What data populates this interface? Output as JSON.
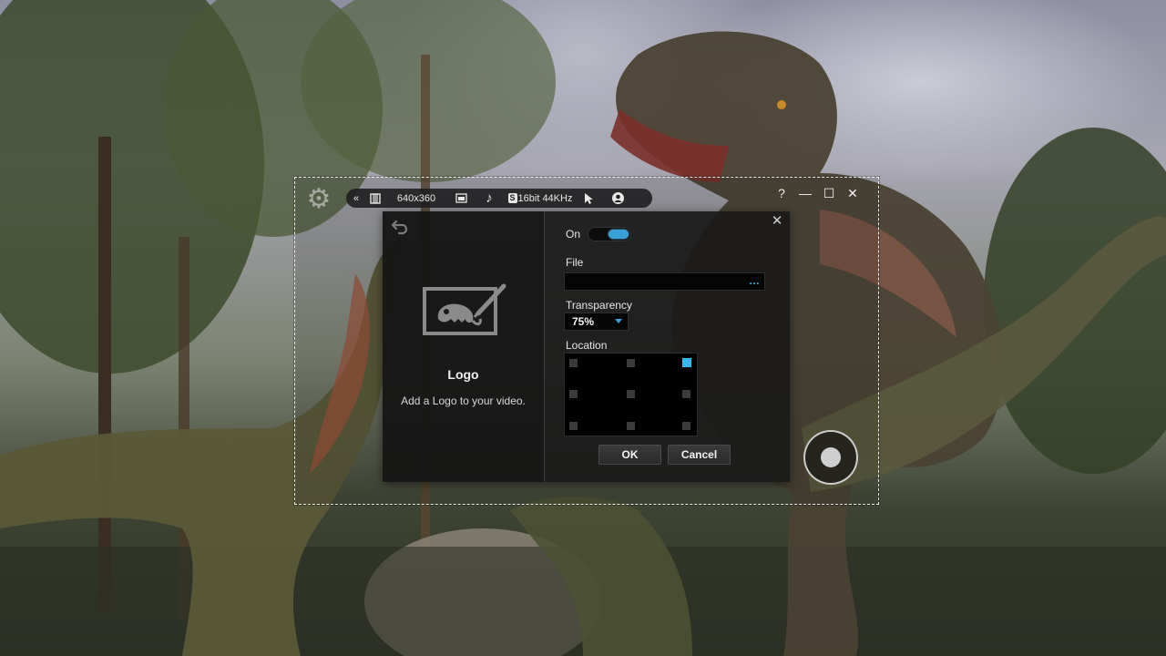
{
  "toolbar": {
    "resolution": "640x360",
    "audio": "16bit 44KHz",
    "audio_badge": "S"
  },
  "dialog": {
    "title": "Logo",
    "description": "Add a Logo to your video.",
    "on_label": "On",
    "on_state": true,
    "file_label": "File",
    "file_value": "",
    "browse_label": "…",
    "transparency_label": "Transparency",
    "transparency_value": "75%",
    "location_label": "Location",
    "location_selected": "top-right",
    "ok_label": "OK",
    "cancel_label": "Cancel"
  },
  "colors": {
    "accent": "#3aa0d8",
    "dialog_bg": "#1a1a1a"
  },
  "icons": [
    "gear-icon",
    "collapse-icon",
    "film-icon",
    "window-icon",
    "music-note-icon",
    "cursor-icon",
    "webcam-icon",
    "help-icon",
    "minimize-icon",
    "maximize-icon",
    "close-icon",
    "back-arrow-icon",
    "logo-chameleon-icon",
    "record-icon"
  ]
}
